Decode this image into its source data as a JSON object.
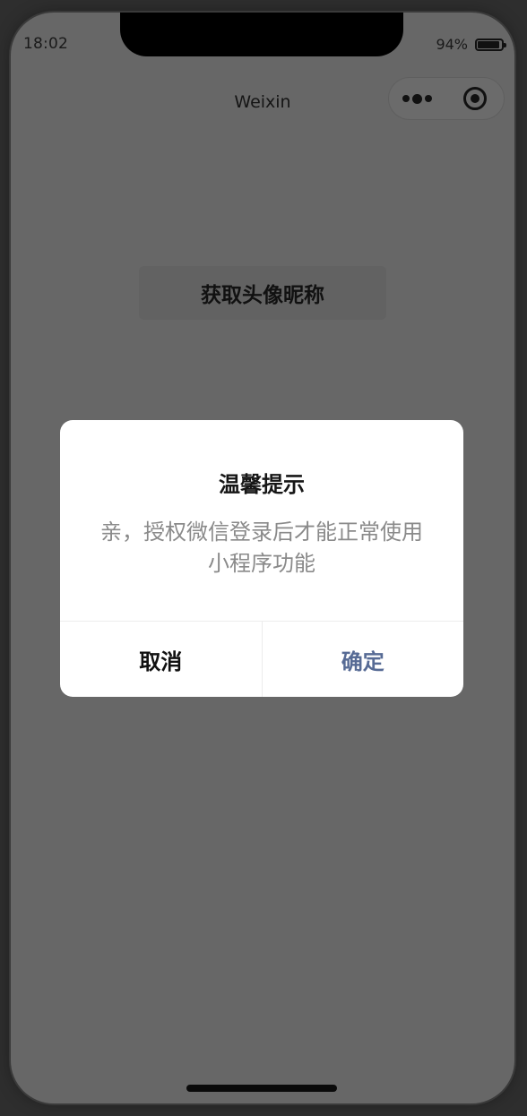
{
  "status_bar": {
    "time": "18:02",
    "battery_percent": "94%",
    "battery_level": 0.94
  },
  "nav": {
    "title": "Weixin",
    "more_icon": "more-dots-icon",
    "close_icon": "target-circle-icon"
  },
  "main": {
    "button_label": "获取头像昵称"
  },
  "modal": {
    "title": "温馨提示",
    "content": "亲，授权微信登录后才能正常使用小程序功能",
    "cancel_label": "取消",
    "confirm_label": "确定"
  },
  "colors": {
    "overlay_bg": "#676767",
    "confirm_text": "#576b95",
    "modal_bg": "#ffffff",
    "content_text": "#8a8a8a"
  }
}
